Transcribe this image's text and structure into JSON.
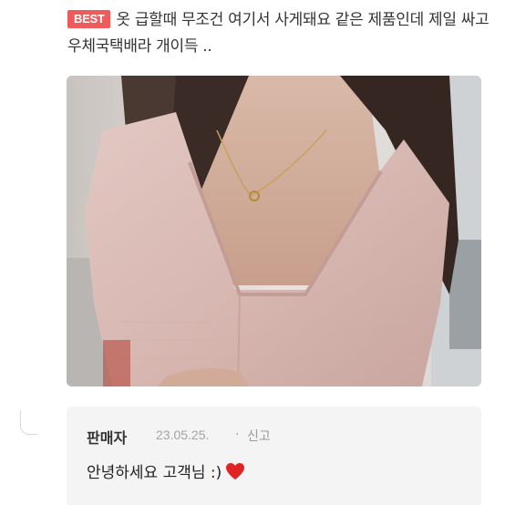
{
  "review": {
    "badge": "BEST",
    "text": "옷 급할때 무조건 여기서 사게돼요 같은 제품인데 제일 싸고 우체국택배라 개이득 .."
  },
  "photo": {
    "icon": "review-photo"
  },
  "reply": {
    "seller": "판매자",
    "date": "23.05.25.",
    "separator": "·",
    "report": "신고",
    "message": "안녕하세요 고객님 :)",
    "icon": "heart-icon",
    "heart_color": "#e02424"
  }
}
